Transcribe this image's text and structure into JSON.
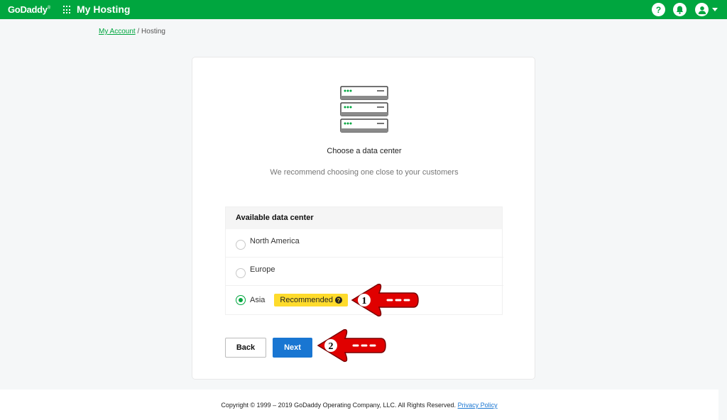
{
  "header": {
    "logo": "GoDaddy",
    "logo_mark": "®",
    "app_title": "My Hosting",
    "help_glyph": "?"
  },
  "breadcrumb": {
    "link": "My Account",
    "separator": " / ",
    "current": "Hosting"
  },
  "card": {
    "heading": "Choose a data center",
    "subheading": "We recommend choosing one close to your customers",
    "panel_title": "Available data center",
    "options": [
      {
        "label": "North America",
        "selected": false
      },
      {
        "label": "Europe",
        "selected": false
      },
      {
        "label": "Asia",
        "selected": true,
        "badge": "Recommended"
      }
    ],
    "badge_help_glyph": "?",
    "back_label": "Back",
    "next_label": "Next"
  },
  "annotations": {
    "arrow1_number": "1",
    "arrow2_number": "2"
  },
  "footer": {
    "copyright": "Copyright © 1999 – 2019 GoDaddy Operating Company, LLC. All Rights Reserved.",
    "privacy_link": "Privacy Policy"
  },
  "colors": {
    "brand_green": "#00a63f",
    "primary_blue": "#1976d2",
    "badge_yellow": "#fedb2c",
    "arrow_red": "#e00000"
  }
}
